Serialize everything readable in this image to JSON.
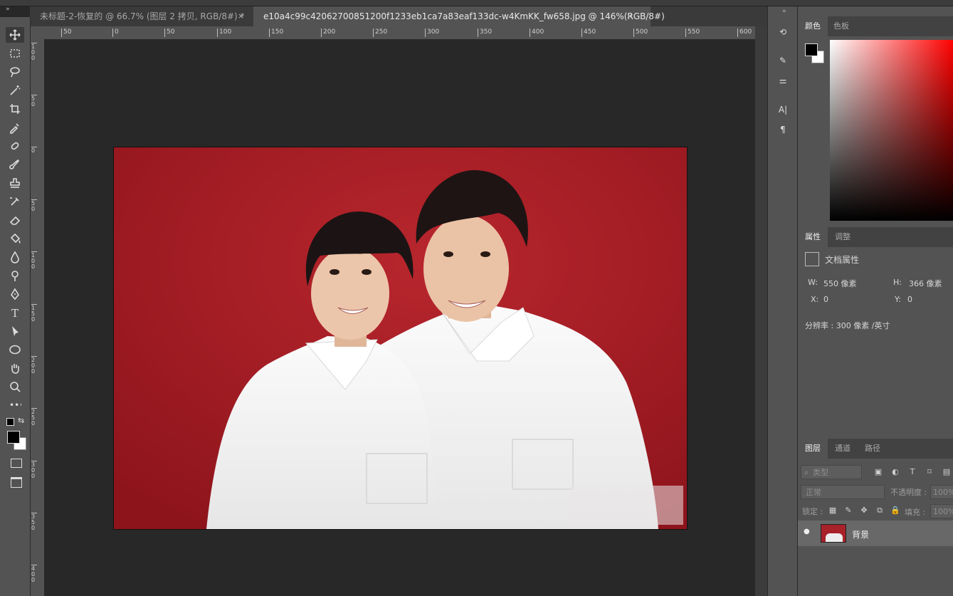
{
  "window": {
    "collapse_left": "»",
    "collapse_right": "«"
  },
  "tabs": [
    {
      "label": "未标题-2-恢复的 @ 66.7% (图层 2 拷贝, RGB/8#) *",
      "close": "×"
    },
    {
      "label": "e10a4c99c42062700851200f1233eb1ca7a83eaf133dc-w4KmKK_fw658.jpg @ 146%(RGB/8#)",
      "close": "×"
    }
  ],
  "rulers": {
    "h": [
      "50",
      "0",
      "50",
      "100",
      "150",
      "200",
      "250",
      "300",
      "350",
      "400",
      "450",
      "500",
      "550",
      "600"
    ],
    "v": [
      "1 0 0",
      "5 0",
      "0",
      "5 0",
      "1 0 0",
      "1 5 0",
      "2 0 0",
      "2 5 0",
      "3 0 0",
      "3 5 0",
      "4 0 0"
    ]
  },
  "tools": [
    "move-icon",
    "marquee-icon",
    "lasso-icon",
    "magic-wand-icon",
    "crop-icon",
    "eyedropper-icon",
    "healing-brush-icon",
    "brush-icon",
    "clone-stamp-icon",
    "history-brush-icon",
    "eraser-icon",
    "paint-bucket-icon",
    "blur-icon",
    "dodge-icon",
    "pen-icon",
    "type-icon",
    "path-select-icon",
    "ellipse-icon",
    "hand-icon",
    "zoom-icon",
    "more-tools-icon"
  ],
  "toolbar": {
    "type_glyph": "T",
    "more_glyph": "•••",
    "swap_glyph": "⇆"
  },
  "dock": {
    "history_glyph": "⟲",
    "adjust_glyph": "⚌",
    "char_glyph": "A|",
    "para_glyph": "¶",
    "brush_glyph": "✎"
  },
  "color_panel": {
    "tabs": [
      "颜色",
      "色板"
    ],
    "fg_color": "#000000",
    "bg_color": "#ffffff",
    "hue_color": "#ff0000"
  },
  "properties_panel": {
    "tabs": [
      "属性",
      "调整"
    ],
    "section_title": "文档属性",
    "w_label": "W:",
    "w_value": "550 像素",
    "h_label": "H:",
    "h_value": "366 像素",
    "x_label": "X:",
    "x_value": "0",
    "y_label": "Y:",
    "y_value": "0",
    "resolution": "分辨率 : 300 像素 /英寸"
  },
  "layers_panel": {
    "tabs": [
      "图层",
      "通道",
      "路径"
    ],
    "filter_placeholder": "类型",
    "filter_icons": [
      "T"
    ],
    "blend_mode": "正常",
    "opacity_label": "不透明度 :",
    "opacity_value": "100%",
    "lock_label": "锁定 :",
    "fill_label": "填充 :",
    "fill_value": "100%",
    "layers": [
      {
        "name": "背景",
        "visible": true
      }
    ],
    "eye_glyph": "●"
  },
  "photo": {
    "background_color": "#b0212a",
    "shirt_color": "#f4f4f4"
  }
}
